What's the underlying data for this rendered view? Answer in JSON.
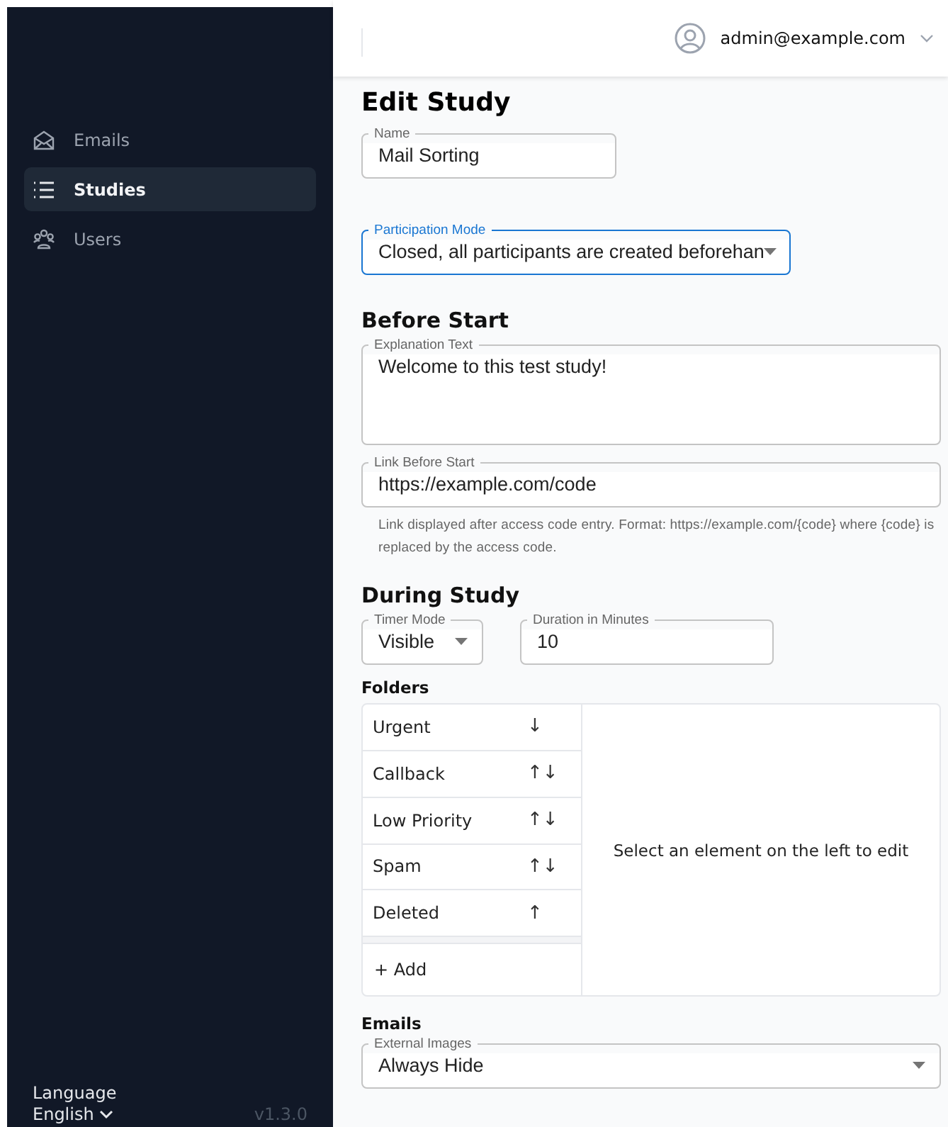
{
  "sidebar": {
    "items": [
      {
        "label": "Emails",
        "kind": "envelope",
        "selected": false
      },
      {
        "label": "Studies",
        "kind": "list",
        "selected": true
      },
      {
        "label": "Users",
        "kind": "users",
        "selected": false
      }
    ],
    "language": {
      "label": "Language",
      "value": "English"
    },
    "version": "v1.3.0"
  },
  "header": {
    "user": "admin@example.com"
  },
  "page": {
    "title": "Edit Study",
    "name_field": {
      "label": "Name",
      "value": "Mail Sorting",
      "focused": false
    },
    "participation_mode": {
      "label": "Participation Mode",
      "value": "Closed, all participants are created beforehan",
      "focused": true
    },
    "before_start": {
      "heading": "Before Start",
      "explanation": {
        "label": "Explanation Text",
        "value": "Welcome to this test study!",
        "focused": false
      },
      "link": {
        "label": "Link Before Start",
        "value": "https://example.com/code",
        "focused": false
      },
      "helper": "Link displayed after access code entry. Format: https://example.com/{code} where {code} is replaced by the access code."
    },
    "during_study": {
      "heading": "During Study",
      "timer_mode": {
        "label": "Timer Mode",
        "value": "Visible",
        "focused": false
      },
      "duration": {
        "label": "Duration in Minutes",
        "value": "10",
        "focused": false
      }
    },
    "folders": {
      "heading": "Folders",
      "items": [
        {
          "label": "Urgent",
          "moves": "↓"
        },
        {
          "label": "Callback",
          "moves": "↑↓"
        },
        {
          "label": "Low Priority",
          "moves": "↑↓"
        },
        {
          "label": "Spam",
          "moves": "↑↓"
        },
        {
          "label": "Deleted",
          "moves": "↑"
        }
      ],
      "add": "+ Add",
      "placeholder": "Select an element on the left to edit"
    },
    "emails": {
      "heading": "Emails",
      "external_images": {
        "label": "External Images",
        "value": "Always Hide",
        "focused": false
      }
    }
  }
}
